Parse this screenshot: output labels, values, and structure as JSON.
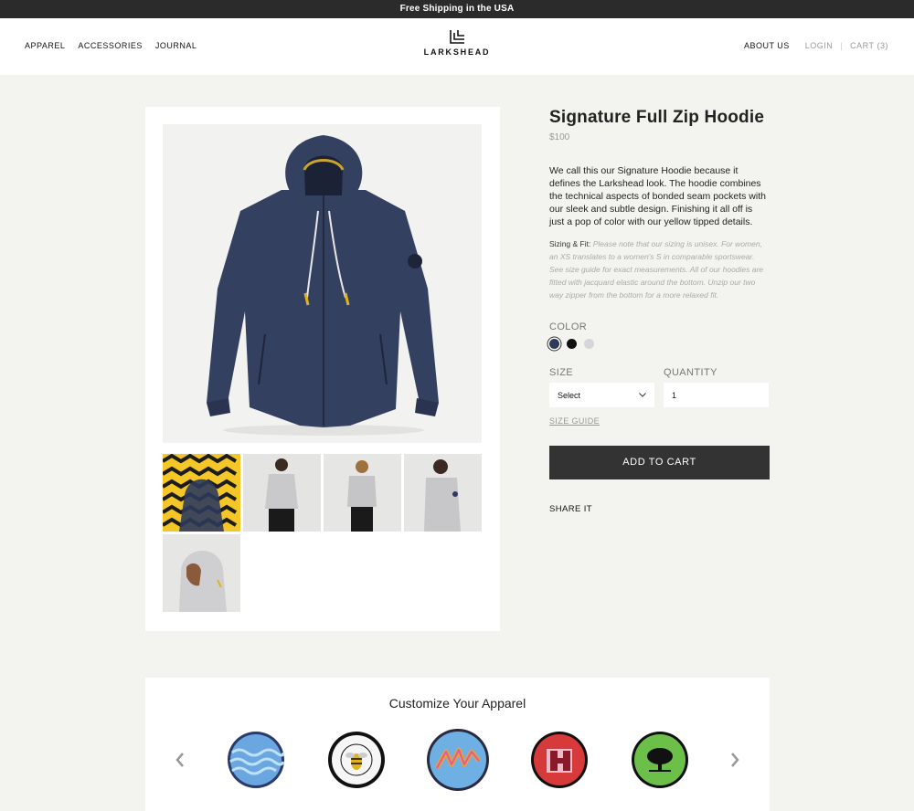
{
  "promo": {
    "text": "Free Shipping in the USA"
  },
  "nav": {
    "left": [
      "APPAREL",
      "ACCESSORIES",
      "JOURNAL"
    ],
    "brand": "LARKSHEAD",
    "about": "ABOUT US",
    "login": "LOGIN",
    "cart": "CART",
    "cart_count": "(3)"
  },
  "product": {
    "title": "Signature Full Zip Hoodie",
    "price": "$100",
    "description": "We call this our Signature Hoodie because it defines the Larkshead look. The hoodie combines the technical aspects of bonded seam pockets with our sleek and subtle design. Finishing it all off is just a pop of color with our yellow tipped details.",
    "sizing_label": "Sizing & Fit:",
    "sizing_text": "Please note that our sizing is unisex. For women, an XS translates to a women's S in comparable sportswear. See size guide for exact measurements. All of our hoodies are fitted with jacquard elastic around the bottom. Unzip our two way zipper from the bottom for a more relaxed fit.",
    "color_label": "COLOR",
    "colors": [
      "#2e3a5c",
      "#111111",
      "#d6d6da"
    ],
    "size_label": "SIZE",
    "size_value": "Select",
    "quantity_label": "QUANTITY",
    "quantity_value": "1",
    "size_guide": "SIZE GUIDE",
    "add_to_cart": "ADD TO CART",
    "share": "SHARE IT"
  },
  "customize": {
    "title": "Customize Your Apparel"
  }
}
